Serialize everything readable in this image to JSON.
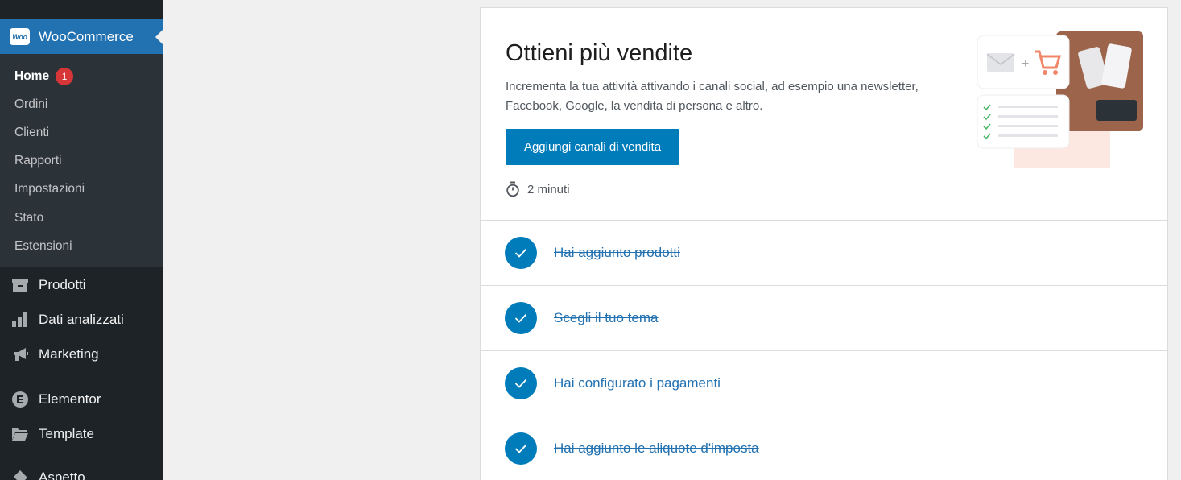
{
  "sidebar": {
    "woocommerce_label": "WooCommerce",
    "woo_logo_text": "Woo",
    "submenu": [
      {
        "label": "Home",
        "badge": "1"
      },
      {
        "label": "Ordini"
      },
      {
        "label": "Clienti"
      },
      {
        "label": "Rapporti"
      },
      {
        "label": "Impostazioni"
      },
      {
        "label": "Stato"
      },
      {
        "label": "Estensioni"
      }
    ],
    "menu": [
      {
        "label": "Prodotti",
        "icon": "archive-icon"
      },
      {
        "label": "Dati analizzati",
        "icon": "bar-chart-icon"
      },
      {
        "label": "Marketing",
        "icon": "megaphone-icon"
      },
      {
        "label": "Elementor",
        "icon": "elementor-icon"
      },
      {
        "label": "Template",
        "icon": "folder-icon"
      },
      {
        "label": "Aspetto",
        "icon": "brush-icon"
      }
    ]
  },
  "hero": {
    "title": "Ottieni più vendite",
    "description": "Incrementa la tua attività attivando i canali social, ad esempio una newsletter, Facebook, Google, la vendita di persona e altro.",
    "button_label": "Aggiungi canali di vendita",
    "time": "2 minuti"
  },
  "tasks": [
    {
      "label": "Hai aggiunto prodotti",
      "done": true
    },
    {
      "label": "Scegli il tuo tema",
      "done": true
    },
    {
      "label": "Hai configurato i pagamenti",
      "done": true
    },
    {
      "label": "Hai aggiunto le aliquote d'imposta",
      "done": true
    }
  ],
  "colors": {
    "sidebar_bg": "#1d2327",
    "submenu_bg": "#2c3338",
    "accent": "#2271b1",
    "button": "#007cba",
    "badge": "#d63638"
  }
}
